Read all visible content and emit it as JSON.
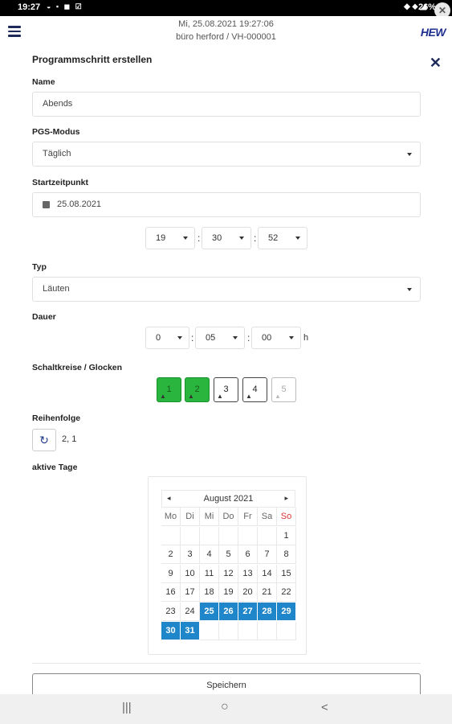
{
  "status_bar": {
    "time": "19:27",
    "icons": "◒ ▪ ◼ ☑",
    "right_icons": "◆ ⬥ ◢",
    "battery": "26%",
    "bubble": "✕"
  },
  "header": {
    "datetime": "Mi, 25.08.2021 19:27:06",
    "location": "büro herford / VH-000001",
    "logo": "HEW",
    "menu_icon": "hamburger-icon"
  },
  "form": {
    "title": "Programmschritt erstellen",
    "close_icon": "✕",
    "name": {
      "label": "Name",
      "value": "Abends"
    },
    "pgs_modus": {
      "label": "PGS-Modus",
      "value": "Täglich"
    },
    "startzeitpunkt": {
      "label": "Startzeitpunkt",
      "date": "25.08.2021",
      "time": {
        "hour": "19",
        "minute": "30",
        "second": "52"
      }
    },
    "typ": {
      "label": "Typ",
      "value": "Läuten"
    },
    "dauer": {
      "label": "Dauer",
      "hours": "0",
      "minutes": "05",
      "seconds": "00",
      "unit": "h"
    },
    "schaltkreise": {
      "label": "Schaltkreise / Glocken",
      "bells": [
        {
          "number": "1",
          "state": "on"
        },
        {
          "number": "2",
          "state": "on"
        },
        {
          "number": "3",
          "state": "off"
        },
        {
          "number": "4",
          "state": "off"
        },
        {
          "number": "5",
          "state": "disabled"
        }
      ]
    },
    "reihenfolge": {
      "label": "Reihenfolge",
      "value": "2, 1",
      "refresh_icon": "↻"
    },
    "aktive_tage": {
      "label": "aktive Tage",
      "month": "August 2021",
      "prev": "◂",
      "next": "▸",
      "weekdays": [
        "Mo",
        "Di",
        "Mi",
        "Do",
        "Fr",
        "Sa",
        "So"
      ],
      "weeks": [
        [
          "",
          "",
          "",
          "",
          "",
          "",
          "1"
        ],
        [
          "2",
          "3",
          "4",
          "5",
          "6",
          "7",
          "8"
        ],
        [
          "9",
          "10",
          "11",
          "12",
          "13",
          "14",
          "15"
        ],
        [
          "16",
          "17",
          "18",
          "19",
          "20",
          "21",
          "22"
        ],
        [
          "23",
          "24",
          "25",
          "26",
          "27",
          "28",
          "29"
        ],
        [
          "30",
          "31",
          "",
          "",
          "",
          "",
          ""
        ]
      ],
      "selected": [
        "25",
        "26",
        "27",
        "28",
        "29",
        "30",
        "31"
      ],
      "accent_color": "#1f86c9",
      "sunday_color": "#dd3333"
    },
    "save_label": "Speichern"
  },
  "nav_bar": {
    "recents": "|||",
    "home": "○",
    "back": "<"
  }
}
